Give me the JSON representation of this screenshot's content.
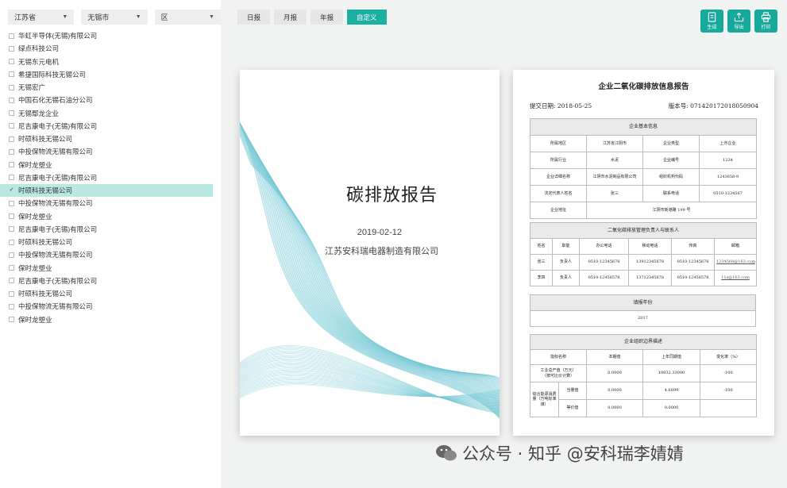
{
  "filters": {
    "province": "江苏省",
    "city": "无锡市",
    "district": "区"
  },
  "companies": [
    {
      "name": "华虹半导体(无锡)有限公司",
      "checked": false
    },
    {
      "name": "绿点科技公司",
      "checked": false
    },
    {
      "name": "无锡东元电机",
      "checked": false
    },
    {
      "name": "希捷国际科技无锡公司",
      "checked": false
    },
    {
      "name": "无锡宏广",
      "checked": false
    },
    {
      "name": "中国石化无锡石油分公司",
      "checked": false
    },
    {
      "name": "无锡鄢龙企业",
      "checked": false
    },
    {
      "name": "尼吉康电子(无锡)有限公司",
      "checked": false
    },
    {
      "name": "时硕科技无锡公司",
      "checked": false
    },
    {
      "name": "中投保物流无锡有限公司",
      "checked": false
    },
    {
      "name": "保时龙塑业",
      "checked": false
    },
    {
      "name": "尼吉康电子(无锡)有限公司",
      "checked": false
    },
    {
      "name": "时硕科技无锡公司",
      "checked": true
    },
    {
      "name": "中投保物流无锡有限公司",
      "checked": false
    },
    {
      "name": "保时龙塑业",
      "checked": false
    },
    {
      "name": "尼吉康电子(无锡)有限公司",
      "checked": false
    },
    {
      "name": "时硕科技无锡公司",
      "checked": false
    },
    {
      "name": "中投保物流无锡有限公司",
      "checked": false
    },
    {
      "name": "保时龙塑业",
      "checked": false
    },
    {
      "name": "尼吉康电子(无锡)有限公司",
      "checked": false
    },
    {
      "name": "时硕科技无锡公司",
      "checked": false
    },
    {
      "name": "中投保物流无锡有限公司",
      "checked": false
    },
    {
      "name": "保时龙塑业",
      "checked": false
    }
  ],
  "tabs": [
    {
      "label": "日报",
      "active": false
    },
    {
      "label": "月报",
      "active": false
    },
    {
      "label": "年报",
      "active": false
    },
    {
      "label": "自定义",
      "active": true
    }
  ],
  "actions": {
    "generate": "生成",
    "export": "导出",
    "print": "打印"
  },
  "cover": {
    "title": "碳排放报告",
    "date": "2019-02-12",
    "company": "江苏安科瑞电器制造有限公司"
  },
  "report": {
    "title": "企业二氧化碳排放信息报告",
    "submit_date": "提交日期: 2018-05-25",
    "version": "版本号: 07142017201805090​4",
    "basic": {
      "heading": "企业基本信息",
      "rows": [
        [
          "所属地区",
          "江苏省江阴市",
          "企业类型",
          "上市企业"
        ],
        [
          "所属行业",
          "水泥",
          "企业编号",
          "1234"
        ],
        [
          "企业详细名称",
          "江阴市水泥制品有限公司",
          "组织机构代码",
          "1243658-9"
        ],
        [
          "法定代表人姓名",
          "张三",
          "联系电话",
          "0510-1234567"
        ]
      ],
      "address_label": "企业地址",
      "address": "江阴市新港路 199 号"
    },
    "contacts": {
      "heading": "二氧化碳排放管理负责人与联系人",
      "headers": [
        "姓名",
        "职能",
        "办公电话",
        "移动电话",
        "传真",
        "邮箱"
      ],
      "rows": [
        [
          "张三",
          "负责人",
          "0510-12345678",
          "13912345678",
          "0510-12345678",
          "1234568@163.com"
        ],
        [
          "李四",
          "负责人",
          "0510-12456578",
          "13712345678",
          "0510-12456578",
          "11s@163.com"
        ]
      ]
    },
    "year": {
      "heading": "填报年份",
      "value": "2017"
    },
    "boundary": {
      "heading": "企业组织边界描述",
      "headers": [
        "指标名称",
        "本期值",
        "上年同期值",
        "变化率（%）"
      ],
      "row1": [
        "工业总产值（万元）\n（按可比价计算）",
        "0.0000",
        "10832.33000",
        "-100"
      ],
      "group_label": "综合能源消费量（万吨标准煤）",
      "row2": [
        "当量值",
        "0.0000",
        "4.6899",
        "-100"
      ],
      "row3": [
        "等价值",
        "0.0000",
        "0.0000",
        ""
      ]
    }
  },
  "watermark": "公众号 · 知乎 @安科瑞李婧婧"
}
